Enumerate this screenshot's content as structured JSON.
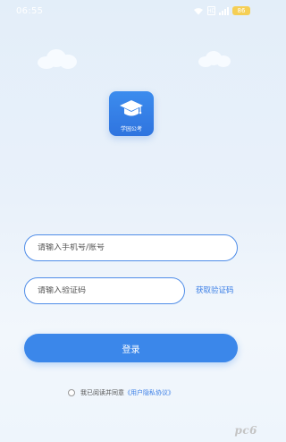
{
  "status_bar": {
    "time": "06:55",
    "battery": "86",
    "sim_label": "HD"
  },
  "app": {
    "name": "学园公考",
    "icon": "graduation-cap-icon",
    "brand_color": "#3b87ea"
  },
  "login_form": {
    "phone_placeholder": "请输入手机号/账号",
    "code_placeholder": "请输入验证码",
    "get_code_label": "获取验证码",
    "login_label": "登录"
  },
  "agreement": {
    "prefix": "我已阅读并同意",
    "policy_link": "《用户隐私协议》"
  },
  "watermark": "pc6"
}
